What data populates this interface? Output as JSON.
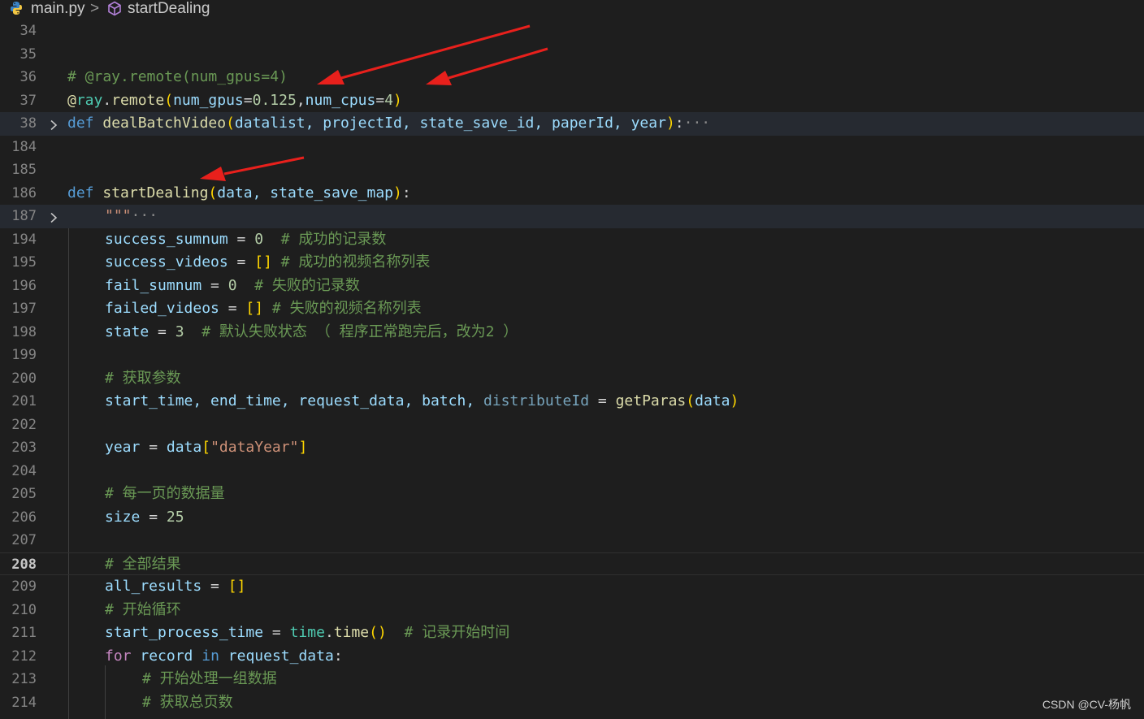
{
  "breadcrumb": {
    "file": "main.py",
    "separator": ">",
    "symbol": "startDealing"
  },
  "lines": {
    "l34": {
      "n": "34"
    },
    "l35": {
      "n": "35"
    },
    "l36": {
      "n": "36",
      "t": "# @ray.remote(num_gpus=4)"
    },
    "l37": {
      "n": "37",
      "at": "@",
      "ray": "ray",
      "dot": ".",
      "remote": "remote",
      "open": "(",
      "p1": "num_gpus",
      "eq1": "=",
      "v1": "0.125",
      "comma": ",",
      "p2": "num_cpus",
      "eq2": "=",
      "v2": "4",
      "close": ")"
    },
    "l38": {
      "n": "38",
      "kw": "def",
      "fn": "dealBatchVideo",
      "open": "(",
      "params": "datalist, projectId, state_save_id, paperId, year",
      "close": ")",
      "colon": ":",
      "fold": "···"
    },
    "l184": {
      "n": "184"
    },
    "l185": {
      "n": "185"
    },
    "l186": {
      "n": "186",
      "kw": "def",
      "fn": "startDealing",
      "open": "(",
      "params": "data, state_save_map",
      "close": ")",
      "colon": ":"
    },
    "l187": {
      "n": "187",
      "doc": "\"\"\"",
      "fold": "···"
    },
    "l194": {
      "n": "194",
      "var": "success_sumnum",
      "op": " = ",
      "num": "0",
      "cm": "  # 成功的记录数"
    },
    "l195": {
      "n": "195",
      "var": "success_videos",
      "op": " = ",
      "br": "[]",
      "cm": " # 成功的视频名称列表"
    },
    "l196": {
      "n": "196",
      "var": "fail_sumnum",
      "op": " = ",
      "num": "0",
      "cm": "  # 失败的记录数"
    },
    "l197": {
      "n": "197",
      "var": "failed_videos",
      "op": " = ",
      "br": "[]",
      "cm": " # 失败的视频名称列表"
    },
    "l198": {
      "n": "198",
      "var": "state",
      "op": " = ",
      "num": "3",
      "cm": "  # 默认失败状态 （ 程序正常跑完后，改为2 ）"
    },
    "l199": {
      "n": "199"
    },
    "l200": {
      "n": "200",
      "cm": "# 获取参数"
    },
    "l201": {
      "n": "201",
      "vars": "start_time, end_time, request_data, batch, ",
      "dim": "distributeId",
      "op": " = ",
      "fn": "getParas",
      "open": "(",
      "arg": "data",
      "close": ")"
    },
    "l202": {
      "n": "202"
    },
    "l203": {
      "n": "203",
      "var": "year",
      "op": " = ",
      "var2": "data",
      "open": "[",
      "str": "\"dataYear\"",
      "close": "]"
    },
    "l204": {
      "n": "204"
    },
    "l205": {
      "n": "205",
      "cm": "# 每一页的数据量"
    },
    "l206": {
      "n": "206",
      "var": "size",
      "op": " = ",
      "num": "25"
    },
    "l207": {
      "n": "207"
    },
    "l208": {
      "n": "208",
      "cm": "# 全部结果"
    },
    "l209": {
      "n": "209",
      "var": "all_results",
      "op": " = ",
      "br": "[]"
    },
    "l210": {
      "n": "210",
      "cm": "# 开始循环"
    },
    "l211": {
      "n": "211",
      "var": "start_process_time",
      "op": " = ",
      "cls": "time",
      "dot": ".",
      "fn": "time",
      "paren": "()",
      "cm": "  # 记录开始时间"
    },
    "l212": {
      "n": "212",
      "kw": "for",
      "v1": "record",
      "in": "in",
      "v2": "request_data",
      "colon": ":"
    },
    "l213": {
      "n": "213",
      "cm": "# 开始处理一组数据"
    },
    "l214": {
      "n": "214",
      "cm": "# 获取总页数"
    }
  },
  "watermark": "CSDN @CV-杨帆",
  "colors": {
    "background": "#1e1e1e",
    "keyword": "#569cd6",
    "function": "#dcdcaa",
    "variable": "#9cdcfe",
    "comment": "#6a9955",
    "string": "#ce9178",
    "arrow": "#e8201c"
  }
}
